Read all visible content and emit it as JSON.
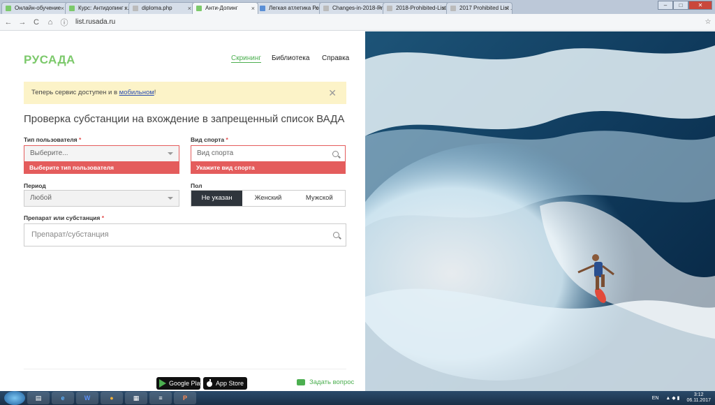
{
  "browser": {
    "tabs": [
      {
        "title": "Онлайн-обучение",
        "active": false,
        "color": "#7cc96b"
      },
      {
        "title": "Курс: Антидопинг к...",
        "active": false,
        "color": "#7cc96b"
      },
      {
        "title": "diploma.php",
        "active": false,
        "color": "#bbbbbb"
      },
      {
        "title": "Анти-Допинг",
        "active": true,
        "color": "#7cc96b"
      },
      {
        "title": "Легкая атлетика Рос...",
        "active": false,
        "color": "#5a8fd6"
      },
      {
        "title": "Changes-in-2018-Pr...",
        "active": false,
        "color": "#bbbbbb"
      },
      {
        "title": "2018-Prohibited-List...",
        "active": false,
        "color": "#bbbbbb"
      },
      {
        "title": "2017 Prohibited List ...",
        "active": false,
        "color": "#bbbbbb"
      }
    ],
    "url": "list.rusada.ru"
  },
  "header": {
    "logo_text": "РУСАДА",
    "nav": [
      {
        "label": "Скрининг",
        "active": true
      },
      {
        "label": "Библиотека",
        "active": false
      },
      {
        "label": "Справка",
        "active": false
      }
    ]
  },
  "banner": {
    "text": "Теперь сервис доступен и в ",
    "link": "мобильном",
    "suffix": "!"
  },
  "form": {
    "title": "Проверка субстанции на вхождение в запрещенный список ВАДА",
    "user_type": {
      "label": "Тип пользователя",
      "placeholder": "Выберите...",
      "error": "Выберите тип пользователя"
    },
    "sport": {
      "label": "Вид спорта",
      "placeholder": "Вид спорта",
      "error": "Укажите вид спорта"
    },
    "period": {
      "label": "Период",
      "value": "Любой"
    },
    "gender": {
      "label": "Пол",
      "options": [
        "Не указан",
        "Женский",
        "Мужской"
      ],
      "selected": "Не указан"
    },
    "substance": {
      "label": "Препарат или субстанция",
      "placeholder": "Препарат/субстанция"
    }
  },
  "footer": {
    "google_play": "Google Play",
    "app_store": "App Store",
    "ask": "Задать вопрос"
  },
  "taskbar": {
    "lang": "EN",
    "time": "3:12",
    "date": "06.11.2017"
  },
  "colors": {
    "accent": "#4caf50",
    "error": "#e45c5c",
    "banner": "#fcf3c8"
  }
}
